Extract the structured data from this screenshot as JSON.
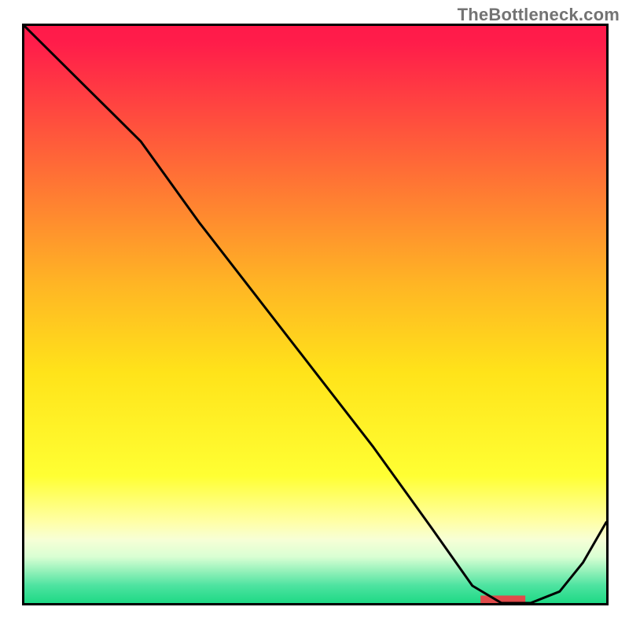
{
  "watermark": "TheBottleneck.com",
  "chart_data": {
    "type": "line",
    "title": "",
    "xlabel": "",
    "ylabel": "",
    "xlim": [
      0,
      100
    ],
    "ylim": [
      0,
      100
    ],
    "background_gradient": {
      "stops": [
        {
          "offset": 0.0,
          "color": "#ff1a4a"
        },
        {
          "offset": 0.03,
          "color": "#ff1d4a"
        },
        {
          "offset": 0.45,
          "color": "#ffb624"
        },
        {
          "offset": 0.6,
          "color": "#ffe31a"
        },
        {
          "offset": 0.78,
          "color": "#ffff33"
        },
        {
          "offset": 0.86,
          "color": "#ffffa8"
        },
        {
          "offset": 0.89,
          "color": "#f7ffd6"
        },
        {
          "offset": 0.92,
          "color": "#d9ffd3"
        },
        {
          "offset": 0.97,
          "color": "#4de3a0"
        },
        {
          "offset": 1.0,
          "color": "#1ed985"
        }
      ]
    },
    "series": [
      {
        "name": "curve",
        "color": "#000000",
        "width": 3,
        "x": [
          0,
          5,
          10,
          15,
          20,
          25,
          30,
          40,
          50,
          60,
          70,
          77,
          82,
          87,
          92,
          96,
          100
        ],
        "y": [
          100,
          95,
          90,
          85,
          80,
          73,
          66,
          53,
          40,
          27,
          13,
          3,
          0,
          0,
          2,
          7,
          14
        ]
      }
    ],
    "annotations": [
      {
        "name": "marker",
        "type": "bar",
        "color": "#e04a4a",
        "x0": 78.4,
        "x1": 86.1,
        "y0": 0.0,
        "y1": 1.3
      }
    ]
  }
}
